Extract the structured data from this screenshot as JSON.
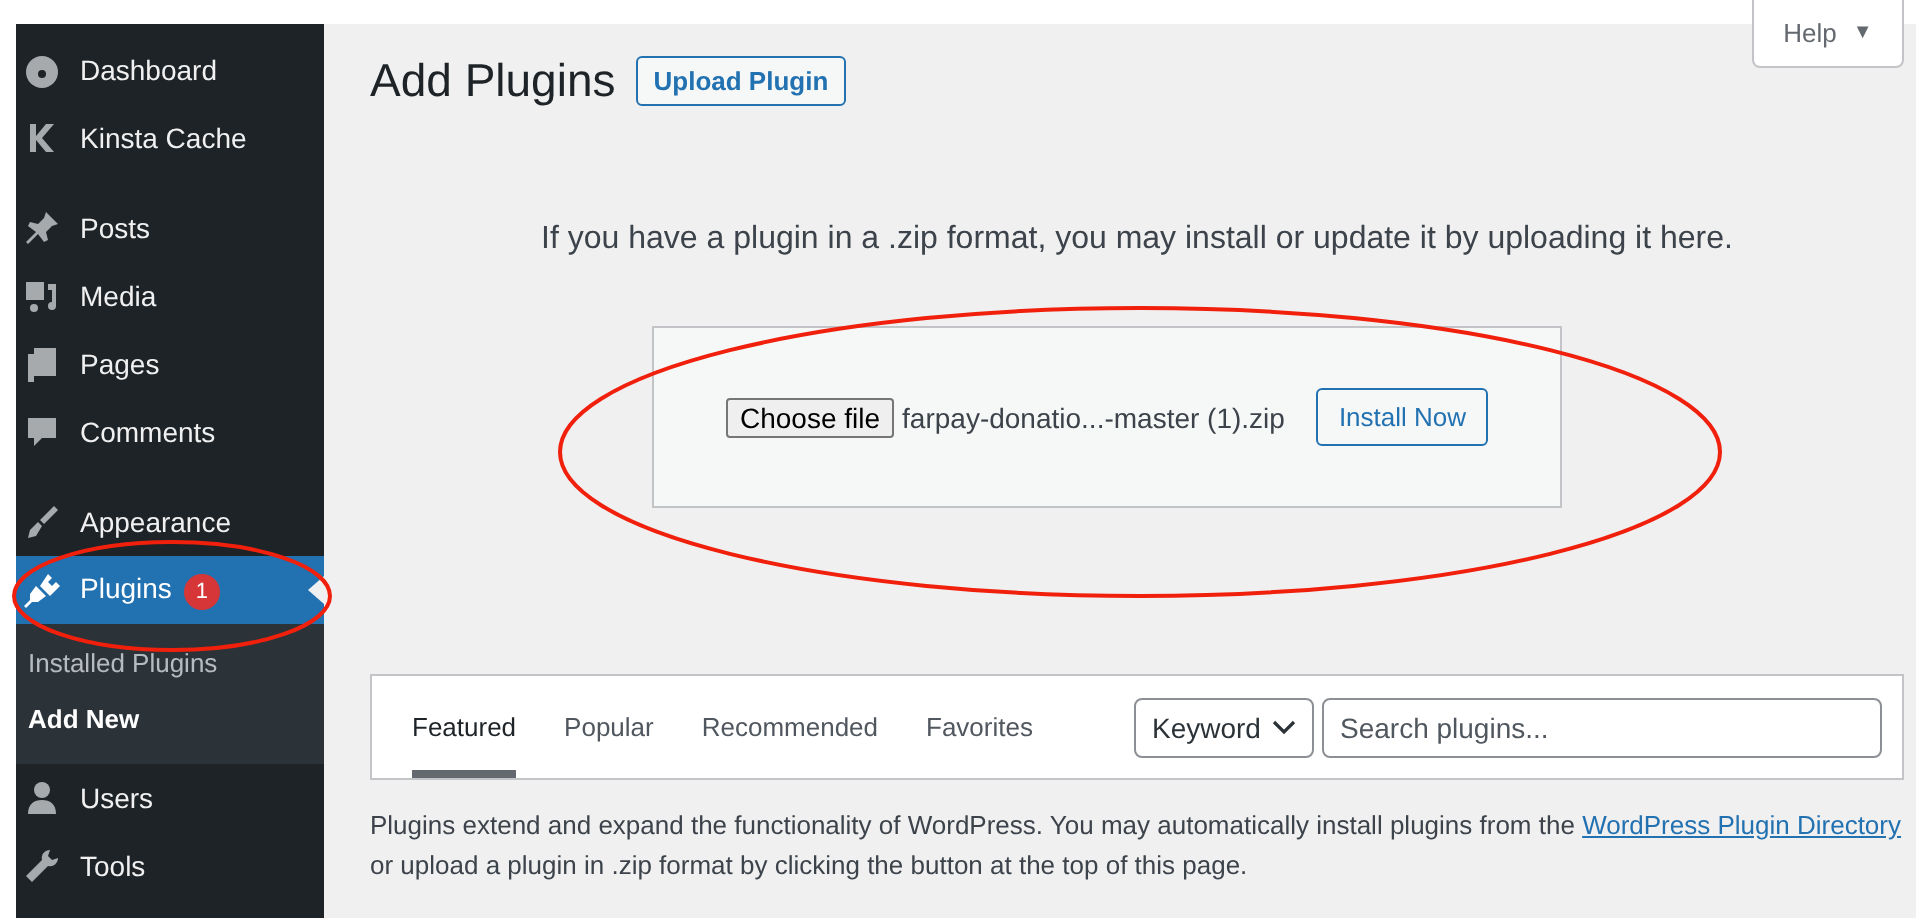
{
  "sidebar": {
    "groups": [
      {
        "items": [
          {
            "kind": "dashboard",
            "label": "Dashboard",
            "selected": false
          },
          {
            "kind": "kinsta",
            "label": "Kinsta Cache",
            "selected": false
          }
        ]
      },
      {
        "items": [
          {
            "kind": "posts",
            "label": "Posts",
            "selected": false
          },
          {
            "kind": "media",
            "label": "Media",
            "selected": false
          },
          {
            "kind": "pages",
            "label": "Pages",
            "selected": false
          },
          {
            "kind": "comments",
            "label": "Comments",
            "selected": false
          }
        ]
      },
      {
        "items": [
          {
            "kind": "appearance",
            "label": "Appearance",
            "selected": false
          },
          {
            "kind": "plugins",
            "label": "Plugins",
            "selected": true,
            "badge": "1",
            "children": [
              {
                "label": "Installed Plugins",
                "selected": false
              },
              {
                "label": "Add New",
                "selected": true
              }
            ]
          },
          {
            "kind": "users",
            "label": "Users",
            "selected": false
          },
          {
            "kind": "tools",
            "label": "Tools",
            "selected": false
          }
        ]
      }
    ]
  },
  "help": {
    "label": "Help",
    "caret": "▼"
  },
  "page_title": "Add Plugins",
  "upload_button": "Upload Plugin",
  "upload": {
    "hint": "If you have a plugin in a .zip format, you may install or update it by uploading it here.",
    "choose_button": "Choose file",
    "file_name": "farpay-donatio...-master (1).zip",
    "install_button": "Install Now"
  },
  "tabs": [
    {
      "label": "Featured",
      "selected": true
    },
    {
      "label": "Popular",
      "selected": false
    },
    {
      "label": "Recommended",
      "selected": false
    },
    {
      "label": "Favorites",
      "selected": false
    }
  ],
  "search": {
    "type": "Keyword",
    "placeholder": "Search plugins..."
  },
  "description": {
    "text": "Plugins extend and expand the functionality of WordPress. You may automatically install plugins from the",
    "link": "WordPress Plugin Directory",
    "rest": "or upload a plugin in .zip format by clicking the button at the top of this page."
  },
  "annotations": [
    {
      "kind": "ellipse",
      "color": "#f0200c"
    },
    {
      "kind": "ellipse",
      "color": "#f0200c"
    }
  ]
}
